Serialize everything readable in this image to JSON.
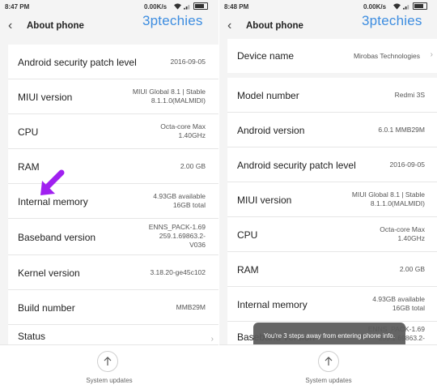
{
  "left": {
    "status": {
      "time": "8:47 PM",
      "speed": "0.00K/s"
    },
    "header": {
      "title": "About phone"
    },
    "watermark": "3ptechies",
    "rows": [
      {
        "label": "Android security patch level",
        "value": "2016-09-05"
      },
      {
        "label": "MIUI version",
        "value1": "MIUI Global 8.1 | Stable",
        "value2": "8.1.1.0(MALMIDI)"
      },
      {
        "label": "CPU",
        "value1": "Octa-core Max",
        "value2": "1.40GHz"
      },
      {
        "label": "RAM",
        "value": "2.00 GB"
      },
      {
        "label": "Internal memory",
        "value1": "4.93GB available",
        "value2": "16GB total"
      },
      {
        "label": "Baseband version",
        "value1": "ENNS_PACK-1.69",
        "value2": "259.1.69863.2-",
        "value3": "V036"
      },
      {
        "label": "Kernel version",
        "value": "3.18.20-ge45c102"
      },
      {
        "label": "Build number",
        "value": "MMB29M"
      },
      {
        "label": "Status"
      }
    ],
    "footer": {
      "updates_label": "System updates"
    },
    "colors": {
      "arrow": "#a020f0"
    }
  },
  "right": {
    "status": {
      "time": "8:48 PM",
      "speed": "0.00K/s"
    },
    "header": {
      "title": "About phone"
    },
    "watermark": "3ptechies",
    "rows": [
      {
        "label": "Device name",
        "value": "Mirobas Technologies"
      },
      {
        "label": "Model number",
        "value": "Redmi 3S"
      },
      {
        "label": "Android version",
        "value": "6.0.1 MMB29M"
      },
      {
        "label": "Android security patch level",
        "value": "2016-09-05"
      },
      {
        "label": "MIUI version",
        "value1": "MIUI Global 8.1 | Stable",
        "value2": "8.1.1.0(MALMIDI)"
      },
      {
        "label": "CPU",
        "value1": "Octa-core Max",
        "value2": "1.40GHz"
      },
      {
        "label": "RAM",
        "value": "2.00 GB"
      },
      {
        "label": "Internal memory",
        "value1": "4.93GB available",
        "value2": "16GB total"
      },
      {
        "label": "Baseband version",
        "value1": "ENNS_PACK-1.69",
        "value2": "259.1.69863.2-"
      }
    ],
    "toast": "You're 3 steps away from entering phone info.",
    "footer": {
      "updates_label": "System updates"
    }
  }
}
